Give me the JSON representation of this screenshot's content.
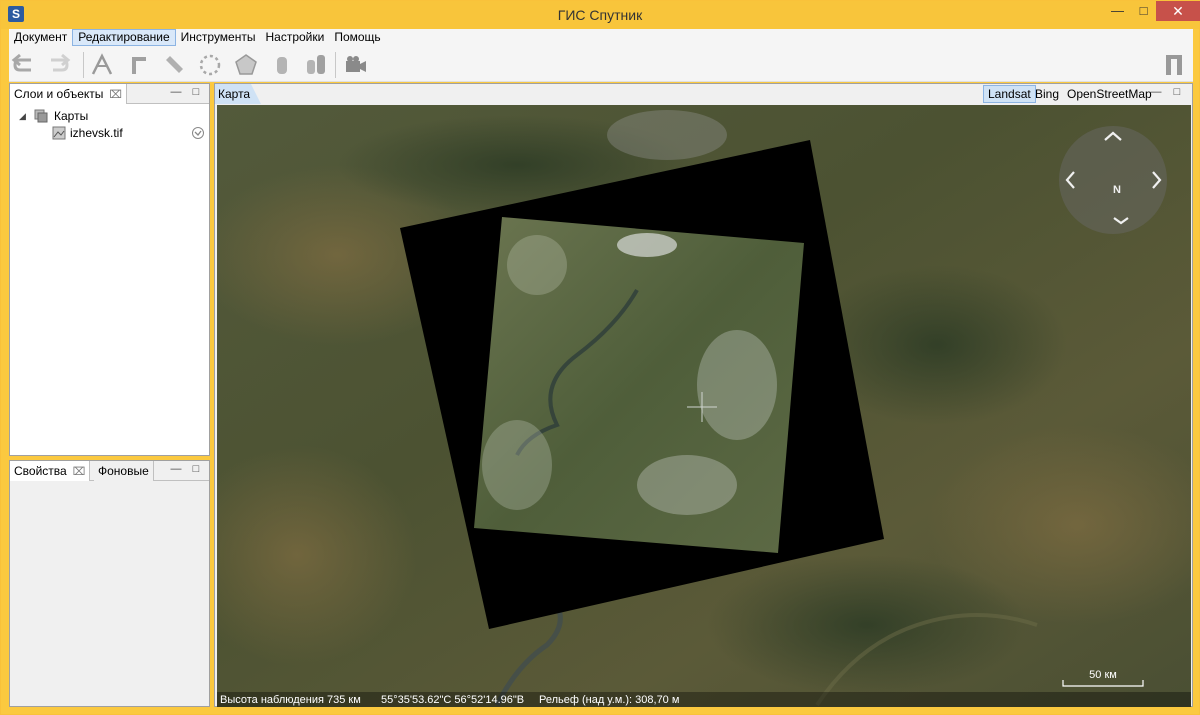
{
  "window": {
    "title": "ГИС Спутник",
    "icon_letter": "S",
    "minimize_icon": "minimize-icon",
    "maximize_icon": "maximize-icon",
    "close_icon": "close-icon"
  },
  "menu": {
    "items": [
      "Документ",
      "Редактирование",
      "Инструменты",
      "Настройки",
      "Помощь"
    ],
    "active": "Редактирование"
  },
  "toolbar": {
    "buttons": [
      "undo-icon",
      "redo-icon",
      "polyline-icon",
      "angle-icon",
      "ruler-icon",
      "circle-icon",
      "polygon-icon",
      "cylinder-icon",
      "columns-icon",
      "camera-icon"
    ],
    "right_button": "panel-icon"
  },
  "layers_panel": {
    "title": "Слои и объекты",
    "tree": {
      "root": "Карты",
      "children": [
        "izhevsk.tif"
      ]
    }
  },
  "props_panel": {
    "tabs": [
      "Свойства",
      "Фоновые"
    ]
  },
  "map": {
    "tab": "Карта",
    "layers": [
      "Landsat",
      "Bing",
      "OpenStreetMap"
    ],
    "active_layer": "Landsat",
    "compass": {
      "north_label": "N"
    },
    "scale_label": "50 км",
    "status": {
      "altitude": "Высота наблюдения 735 км",
      "coords": "55°35'53.62\"С 56°52'14.96\"В",
      "elevation": "Рельеф (над у.м.): 308,70 м"
    }
  },
  "colors": {
    "title_bar": "#f8c53b",
    "close_button": "#c7514a",
    "active_selection": "#cfe2f5"
  }
}
